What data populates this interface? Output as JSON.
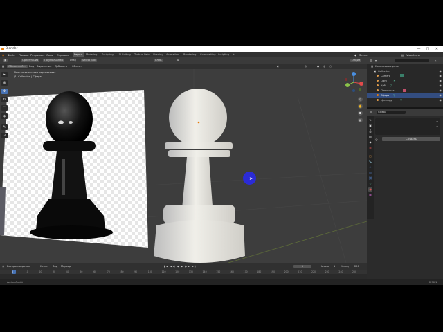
{
  "titlebar": {
    "title": "Blender",
    "minimize": "—",
    "maximize": "□",
    "close": "✕"
  },
  "menu": {
    "items": [
      "Файл",
      "Правка",
      "Рендеринг",
      "Окно",
      "Справка"
    ]
  },
  "workspaces": [
    {
      "label": "Layout",
      "active": true
    },
    {
      "label": "Modeling",
      "active": false
    },
    {
      "label": "Sculpting",
      "active": false
    },
    {
      "label": "UV Editing",
      "active": false
    },
    {
      "label": "Texture Paint",
      "active": false
    },
    {
      "label": "Shading",
      "active": false
    },
    {
      "label": "Animation",
      "active": false
    },
    {
      "label": "Rendering",
      "active": false
    },
    {
      "label": "Compositing",
      "active": false
    },
    {
      "label": "Scripting",
      "active": false
    },
    {
      "label": "+",
      "active": false
    }
  ],
  "scene": {
    "label": "Scene",
    "view_layer": "View Layer"
  },
  "header": {
    "orientation_label": "Ориентация",
    "orientation_value": "По умолчанию",
    "drag_label": "Drag",
    "drag_value": "Select Box",
    "pivot_value": "Глоб.",
    "options_label": "Опции"
  },
  "viewport_header": {
    "mode": "Объектный ...",
    "view": "Вид",
    "select": "Выделение",
    "add": "Добавить",
    "object": "Объект"
  },
  "viewport": {
    "perspective_text": "Пользовательская перспектива",
    "collection_text": "(1) Collection | Сфера"
  },
  "outliner": {
    "title": "Коллекция сцены",
    "rows": [
      {
        "label": "Collection",
        "color": "#cccccc"
      },
      {
        "label": "Camera",
        "color": "#e09b4a"
      },
      {
        "label": "Light",
        "color": "#e09b4a"
      },
      {
        "label": "Куб",
        "color": "#e09b4a"
      },
      {
        "label": "Плоскость",
        "color": "#e09b4a"
      },
      {
        "label": "Сфера",
        "color": "#e09b4a"
      },
      {
        "label": "Цилиндр",
        "color": "#e09b4a"
      }
    ]
  },
  "properties": {
    "search_value": "Сфера",
    "new_button": "Создать"
  },
  "timeline": {
    "playback": "Воспроизведение",
    "keying": "Кеинг",
    "view": "Вид",
    "markers": "Маркер",
    "current_frame": "1",
    "start_label": "Начало",
    "start_value": "1",
    "end_label": "Конец",
    "end_value": "250",
    "ruler_ticks": [
      "0",
      "10",
      "20",
      "30",
      "40",
      "50",
      "60",
      "70",
      "80",
      "90",
      "100",
      "110",
      "120",
      "130",
      "140",
      "150",
      "160",
      "170",
      "180",
      "190",
      "200",
      "210",
      "220",
      "230",
      "240",
      "250"
    ]
  },
  "status": {
    "left": "Action Assist",
    "version": "2.90.1"
  },
  "colors": {
    "accent": "#4772b3",
    "selected_active": "#e87d0d",
    "cursor": "#2b2bd6"
  },
  "icons": [
    "blender-logo-icon",
    "select-tool-icon",
    "cursor-tool-icon",
    "move-tool-icon",
    "rotate-tool-icon",
    "scale-tool-icon",
    "transform-tool-icon",
    "annotate-tool-icon",
    "measure-tool-icon",
    "zoom-icon",
    "hand-icon",
    "camera-icon",
    "grid-icon",
    "eye-icon"
  ]
}
